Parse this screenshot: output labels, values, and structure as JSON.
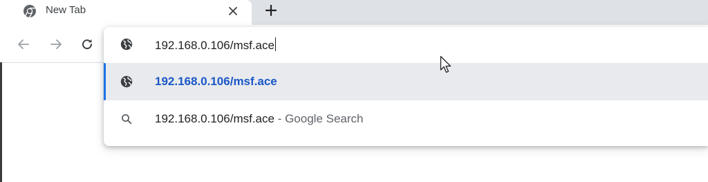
{
  "tab": {
    "title": "New Tab"
  },
  "omnibox": {
    "input_value": "192.168.0.106/msf.ace",
    "suggestions": [
      {
        "type": "url",
        "text": "192.168.0.106/msf.ace",
        "icon": "globe-icon"
      },
      {
        "type": "search",
        "text": "192.168.0.106/msf.ace",
        "separator": " - ",
        "hint": "Google Search",
        "icon": "search-icon"
      }
    ]
  },
  "colors": {
    "selected_accent": "#1a73e8",
    "url_text": "#1a57c7",
    "tabstrip": "#dee1e6"
  }
}
